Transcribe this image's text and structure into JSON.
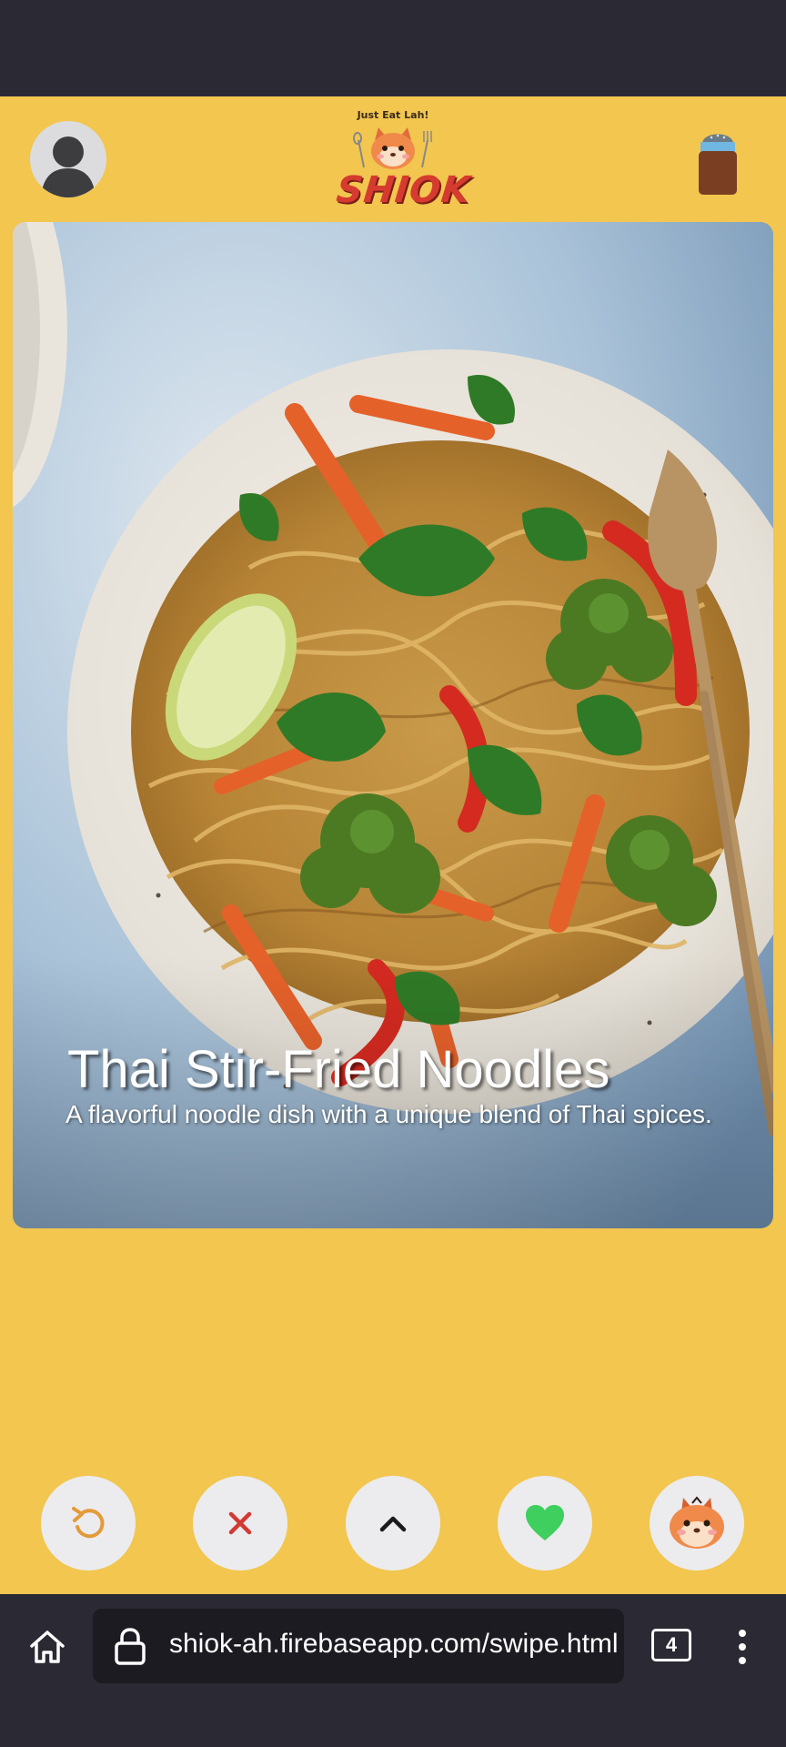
{
  "app": {
    "logo_tagline": "Just Eat Lah!",
    "logo_word": "SHIOK",
    "brand_color": "#f2c64f"
  },
  "card": {
    "title": "Thai Stir-Fried Noodles",
    "description": "A flavorful noodle dish with a unique blend of Thai spices."
  },
  "actions": {
    "undo_icon": "undo-icon",
    "dislike_icon": "close-icon",
    "details_icon": "chevron-up-icon",
    "like_icon": "heart-icon",
    "mascot_icon": "squirrel-mascot-icon"
  },
  "browser": {
    "url": "shiok-ah.firebaseapp.com/swipe.html",
    "tab_count": "4"
  }
}
